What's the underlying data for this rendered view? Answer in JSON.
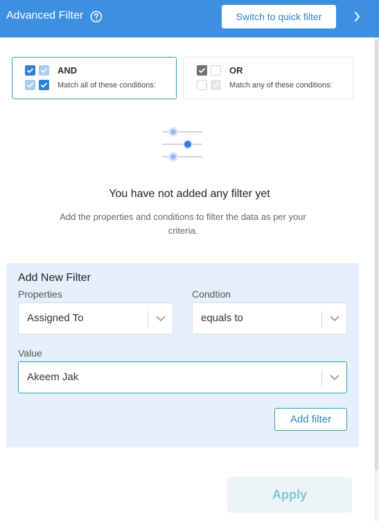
{
  "header": {
    "title": "Advanced Filter",
    "help_icon": "question-circle-icon",
    "quick_filter_label": "Switch to quick filter",
    "collapse_icon": "chevron-right-icon"
  },
  "logic": {
    "and": {
      "label": "AND",
      "description": "Match all of these conditions:",
      "selected": true
    },
    "or": {
      "label": "OR",
      "description": "Match any of these conditions:",
      "selected": false
    }
  },
  "empty_state": {
    "icon": "sliders-icon",
    "title": "You have not added any filter yet",
    "description": "Add the properties and conditions to filter the data as per your criteria."
  },
  "new_filter": {
    "title": "Add New Filter",
    "properties": {
      "label": "Properties",
      "value": "Assigned To"
    },
    "condition": {
      "label": "Condtion",
      "value": "equals to"
    },
    "value": {
      "label": "Value",
      "value": "Akeem Jak"
    },
    "add_label": "Add filter"
  },
  "footer": {
    "apply_label": "Apply"
  },
  "colors": {
    "header": "#3d8fe0",
    "accent_teal": "#2aa3a8",
    "checkbox_blue": "#2f80d6",
    "checkbox_light": "#a9cdef",
    "panel_bg": "#e5f0fc"
  }
}
